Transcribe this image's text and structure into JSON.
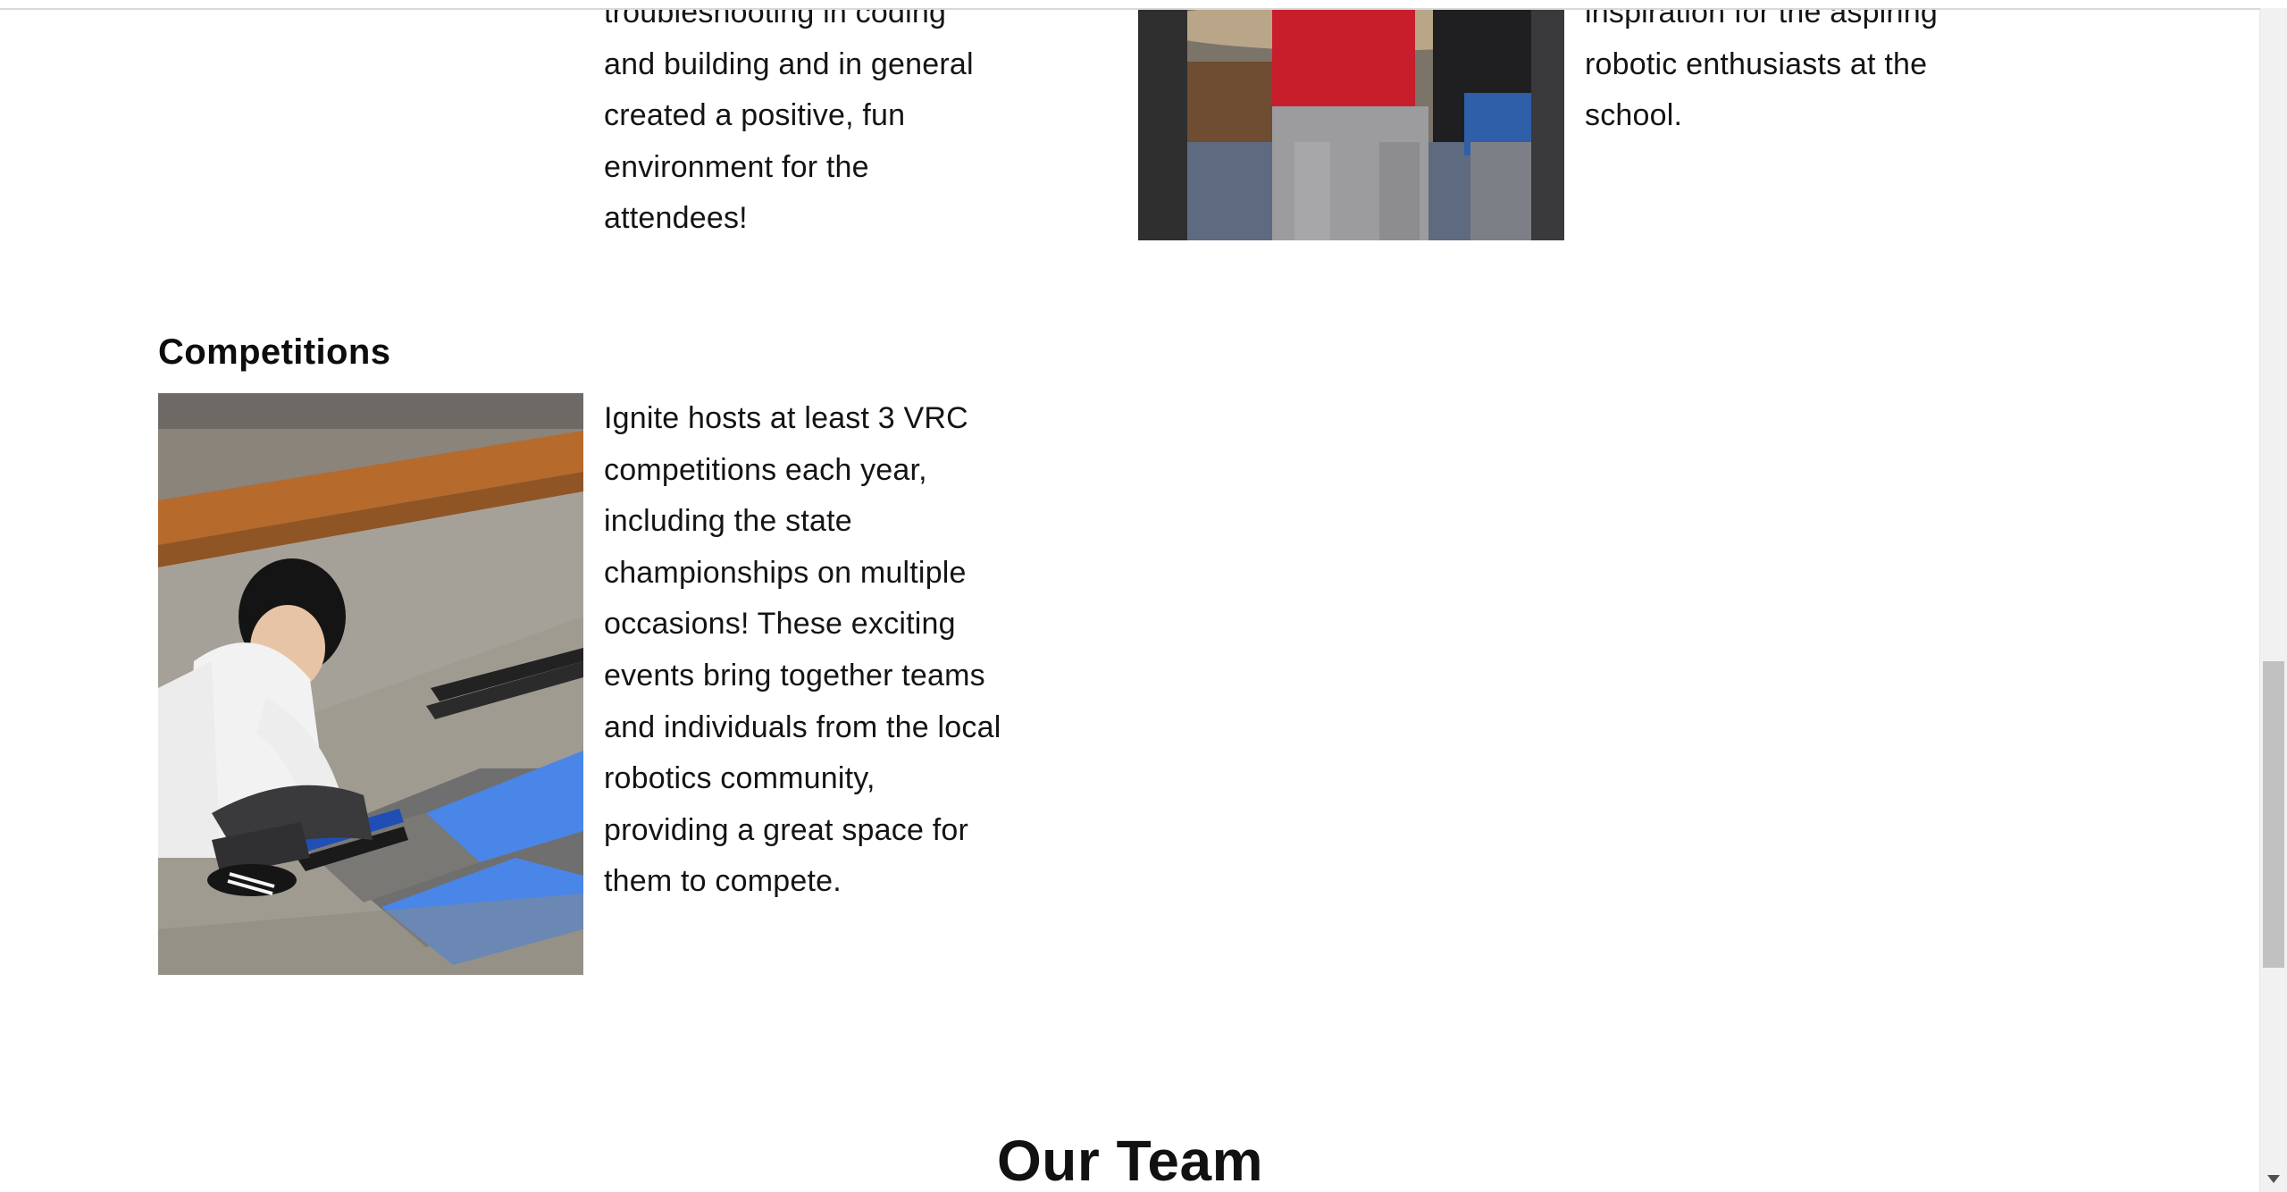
{
  "previous_section": {
    "left_paragraph_lines": [
      "troubleshooting in coding",
      "and building and in general",
      "created a positive, fun",
      "environment for the",
      "attendees!"
    ],
    "right_paragraph_lines": [
      "inspiration for the aspiring",
      "robotic enthusiasts at the",
      "school."
    ]
  },
  "competitions": {
    "heading": "Competitions",
    "paragraph_lines": [
      "Ignite hosts at least 3 VRC",
      "competitions each year,",
      "including the state",
      "championships on multiple",
      "occasions! These exciting",
      "events bring together teams",
      "and individuals from the local",
      "robotics community,",
      "providing a great space for",
      "them to compete."
    ]
  },
  "team": {
    "heading": "Our Team"
  },
  "colors": {
    "text": "#141414",
    "background": "#ffffff",
    "field_tile_blue": "#4a86e8",
    "field_tile_gray": "#6f6f6f",
    "scrollbar_thumb": "#c1c1c1"
  }
}
